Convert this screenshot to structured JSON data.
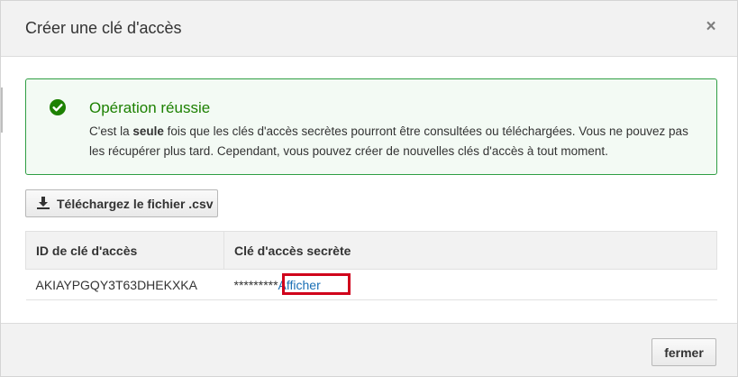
{
  "dialog": {
    "title": "Créer une clé d'accès",
    "close_symbol": "×"
  },
  "alert": {
    "title": "Opération réussie",
    "body_prefix": "C'est la ",
    "body_bold": "seule",
    "body_suffix": " fois que les clés d'accès secrètes pourront être consultées ou téléchargées. Vous ne pouvez pas les récupérer plus tard. Cependant, vous pouvez créer de nouvelles clés d'accès à tout moment.",
    "icon": "check-circle-icon",
    "color": "#1d8102"
  },
  "download": {
    "label": "Téléchargez le fichier .csv",
    "icon": "download-icon"
  },
  "table": {
    "headers": [
      "ID de clé d'accès",
      "Clé d'accès secrète"
    ],
    "rows": [
      {
        "access_key_id": "AKIAYPGQY3T63DHEKXKA",
        "secret_mask": "*********",
        "show_label": "Afficher"
      }
    ]
  },
  "footer": {
    "close_label": "fermer"
  },
  "colors": {
    "highlight": "#d0021b",
    "link": "#1a6fb5"
  }
}
